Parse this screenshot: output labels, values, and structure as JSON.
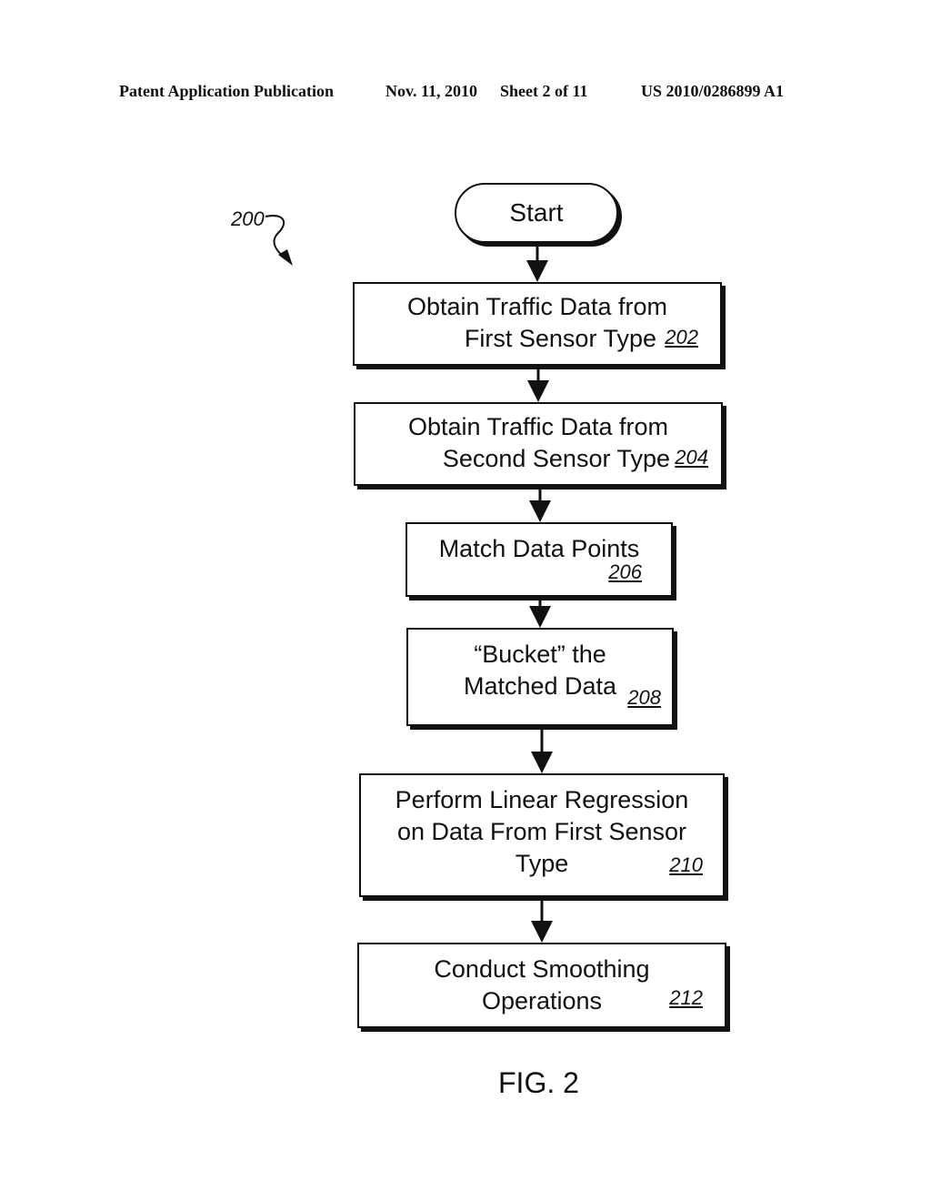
{
  "header": {
    "publication": "Patent Application Publication",
    "date": "Nov. 11, 2010",
    "sheet": "Sheet 2 of 11",
    "patent_number": "US 2010/0286899 A1"
  },
  "diagram": {
    "label": "200",
    "start": "Start",
    "steps": [
      {
        "lines": [
          "Obtain Traffic Data from",
          "First Sensor Type"
        ],
        "ref": "202"
      },
      {
        "lines": [
          "Obtain Traffic Data from",
          "Second Sensor Type"
        ],
        "ref": "204"
      },
      {
        "lines": [
          "Match Data Points"
        ],
        "ref": "206"
      },
      {
        "lines": [
          "“Bucket” the",
          "Matched Data"
        ],
        "ref": "208"
      },
      {
        "lines": [
          "Perform Linear Regression",
          "on Data From First Sensor",
          "Type"
        ],
        "ref": "210"
      },
      {
        "lines": [
          "Conduct Smoothing",
          "Operations"
        ],
        "ref": "212"
      }
    ],
    "figure_caption": "FIG. 2"
  }
}
